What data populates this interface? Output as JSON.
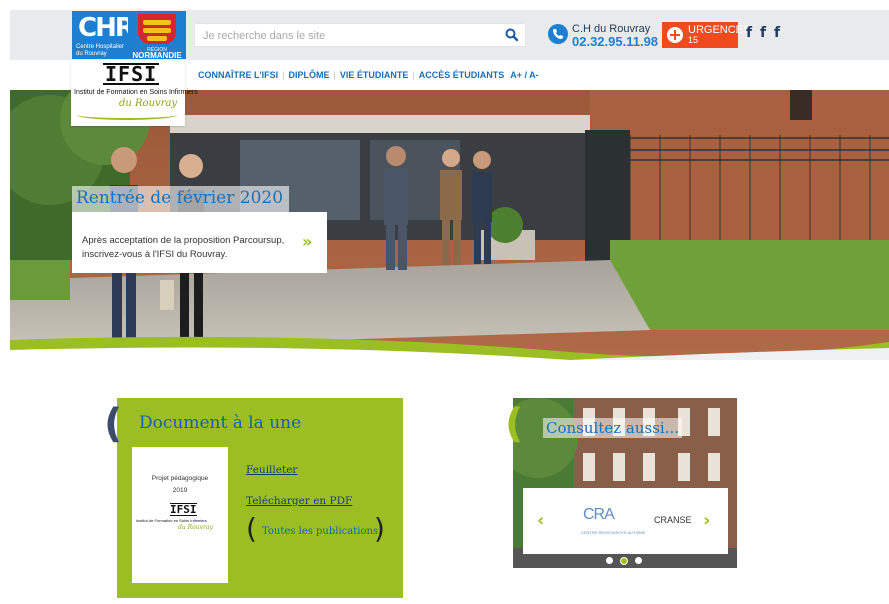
{
  "header": {
    "chr_logo": {
      "mark": "CHR",
      "line1": "Centre Hospitalier",
      "line2": "du Rouvray"
    },
    "region_logo": {
      "line1": "RÉGION",
      "line2": "NORMANDIE"
    },
    "search": {
      "placeholder": "Je recherche dans le site",
      "icon": "search-icon"
    },
    "hospital_name": "C.H du Rouvray",
    "phone": "02.32.95.11.98",
    "urgences": {
      "label": "URGENCES",
      "number": "15"
    },
    "social": [
      "f",
      "f",
      "f"
    ]
  },
  "ifsi_logo": {
    "acronym": "IFSI",
    "full_name": "Institut de Formation en Soins Infirmiers",
    "script": "du Rouvray"
  },
  "nav": {
    "items": [
      "CONNAÎTRE L'IFSI",
      "DIPLÔME",
      "VIE ÉTUDIANTE",
      "ACCÈS ÉTUDIANTS"
    ],
    "font_size": "A+ / A-"
  },
  "hero": {
    "title": "Rentrée de février 2020",
    "text": "Après acceptation de la proposition Parcoursup, inscrivez-vous à l'IFSI du Rouvray.",
    "arrow": "»"
  },
  "document": {
    "title": "Document à la une",
    "cover_title": "Projet pédagogique",
    "cover_year": "2019",
    "cover_acronym": "IFSI",
    "cover_institute": "Institut de Formation en Soins Infirmiers",
    "cover_script": "du Rouvray",
    "read_link": "Feuilleter",
    "download_link": "Telécharger en PDF",
    "all_publications": "Toutes les publications"
  },
  "consultez": {
    "title": "Consultez aussi...",
    "logo_text": "CRA",
    "logo_sub": "CENTRE RESSOURCES AUTISME",
    "partner": "CRANSE",
    "prev": "‹",
    "next": "›",
    "slides": 3,
    "active_slide": 1
  },
  "colors": {
    "green": "#9bbf22",
    "blue": "#1b6fb5",
    "orange": "#f04a1f",
    "topbar": "#e9eaec"
  }
}
